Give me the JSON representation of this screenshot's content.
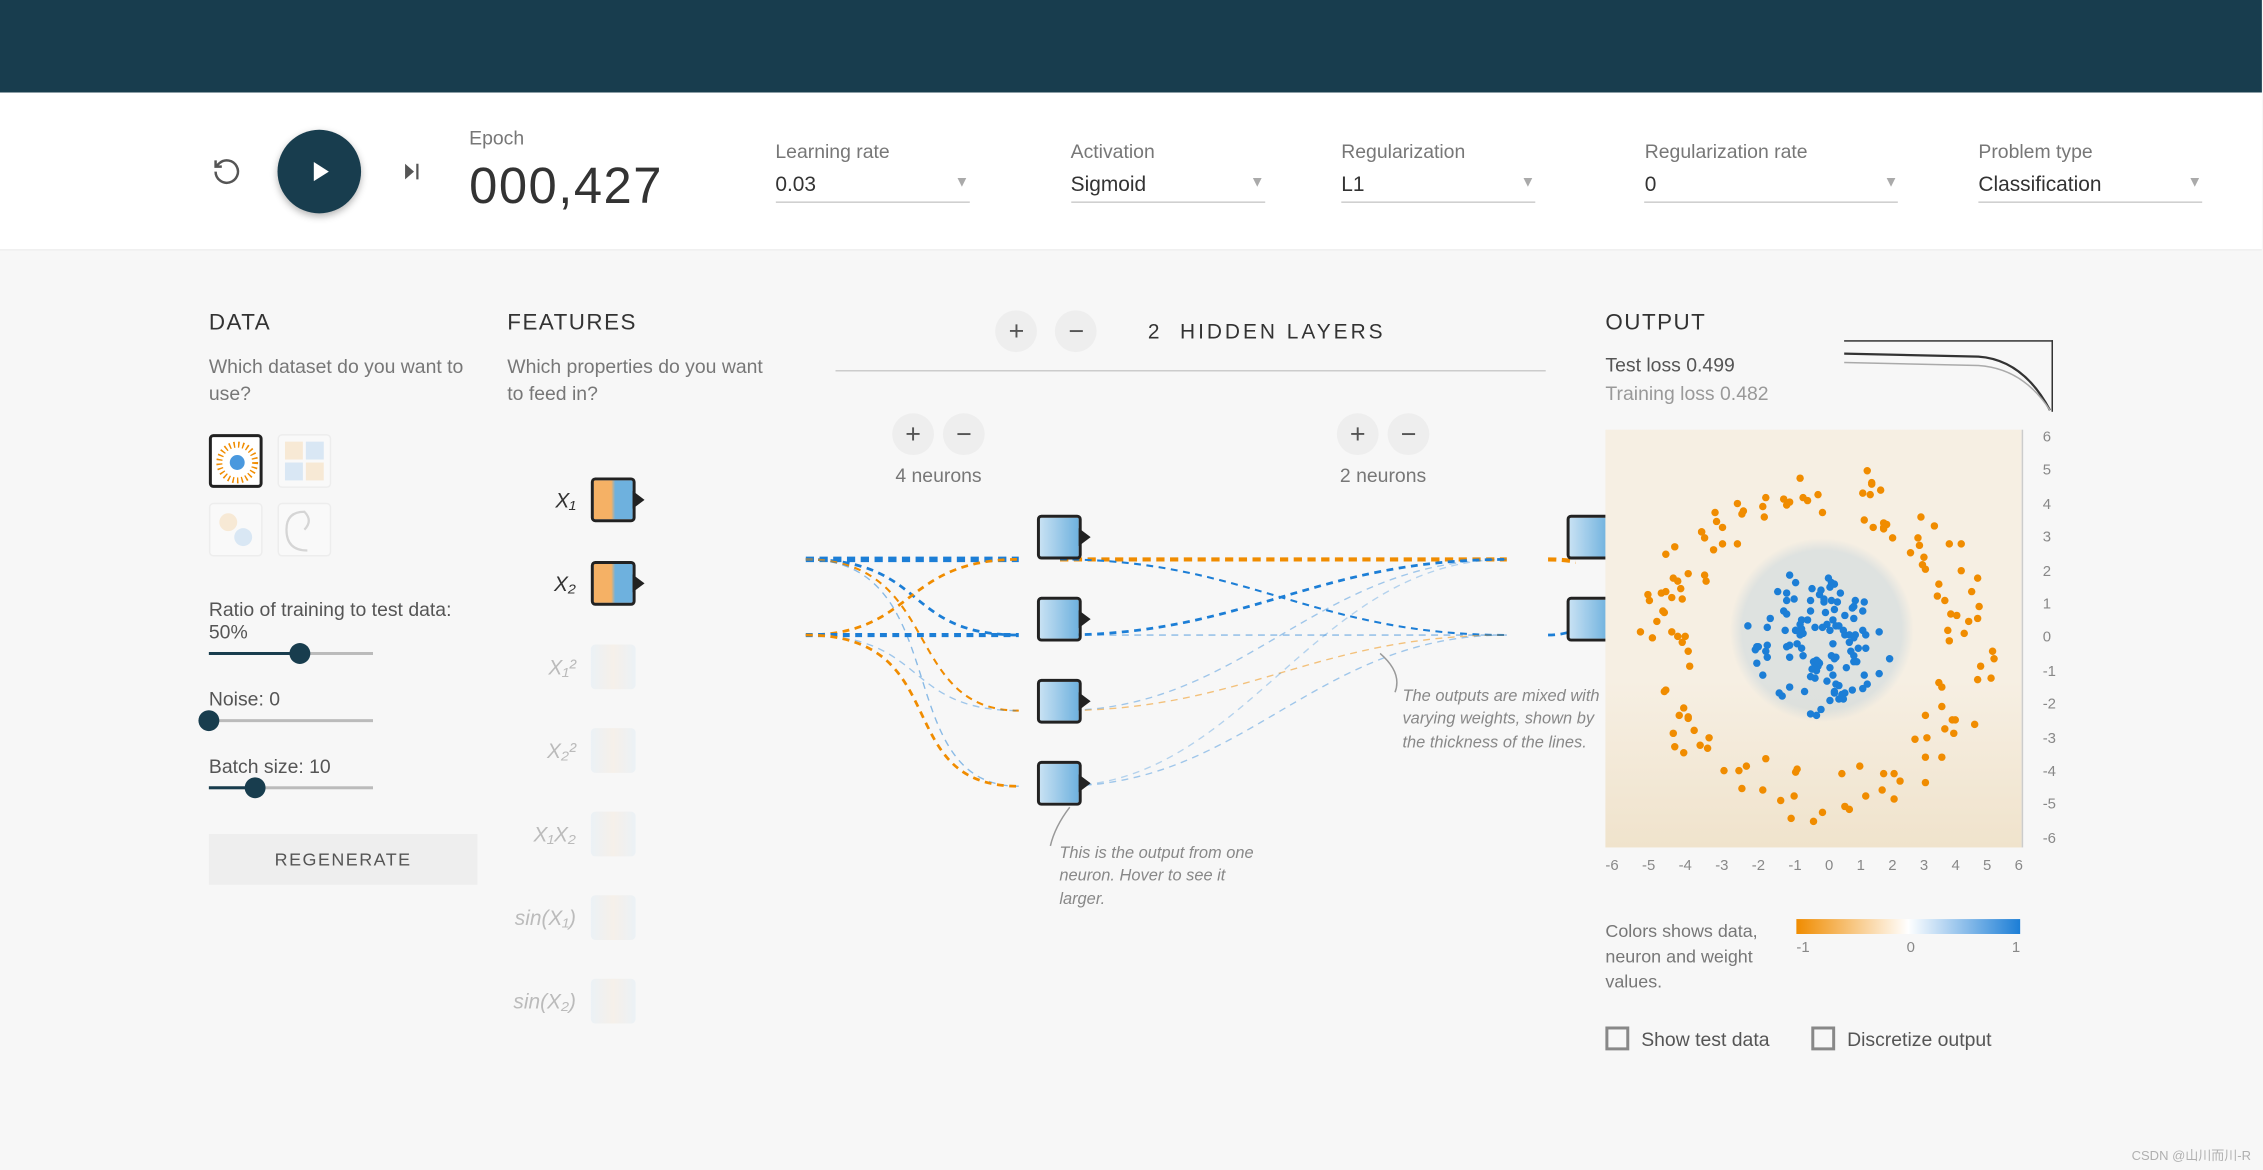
{
  "toolbar": {
    "epoch_label": "Epoch",
    "epoch_value": "000,427",
    "learning_rate_label": "Learning rate",
    "learning_rate_value": "0.03",
    "activation_label": "Activation",
    "activation_value": "Sigmoid",
    "regularization_label": "Regularization",
    "regularization_value": "L1",
    "reg_rate_label": "Regularization rate",
    "reg_rate_value": "0",
    "problem_label": "Problem type",
    "problem_value": "Classification"
  },
  "data_panel": {
    "heading": "DATA",
    "subtext": "Which dataset do you want to use?",
    "ratio_label": "Ratio of training to test data:  50%",
    "noise_label": "Noise:  0",
    "batch_label": "Batch size:  10",
    "regenerate": "REGENERATE"
  },
  "features": {
    "heading": "FEATURES",
    "subtext": "Which properties do you want to feed in?",
    "items": [
      {
        "label": "X₁",
        "active": true
      },
      {
        "label": "X₂",
        "active": true
      },
      {
        "label": "X₁²",
        "active": false
      },
      {
        "label": "X₂²",
        "active": false
      },
      {
        "label": "X₁X₂",
        "active": false
      },
      {
        "label": "sin(X₁)",
        "active": false
      },
      {
        "label": "sin(X₂)",
        "active": false
      }
    ]
  },
  "network": {
    "title": "HIDDEN LAYERS",
    "count": "2",
    "layers": [
      {
        "neurons_label": "4 neurons",
        "neurons": 4
      },
      {
        "neurons_label": "2 neurons",
        "neurons": 2
      }
    ],
    "callout_neuron": "This is the output from one neuron. Hover to see it larger.",
    "callout_weights": "The outputs are mixed with varying weights, shown by the thickness of the lines."
  },
  "output": {
    "heading": "OUTPUT",
    "test_loss": "Test loss 0.499",
    "train_loss": "Training loss 0.482",
    "ticks": [
      "-6",
      "-5",
      "-4",
      "-3",
      "-2",
      "-1",
      "0",
      "1",
      "2",
      "3",
      "4",
      "5",
      "6"
    ],
    "legend_text": "Colors shows data, neuron and weight values.",
    "grad_ticks": [
      "-1",
      "0",
      "1"
    ],
    "show_test": "Show test data",
    "discretize": "Discretize output"
  },
  "watermark": "CSDN @山川而川-R",
  "colors": {
    "blue": "#1c7ed6",
    "orange": "#f08c00",
    "dark": "#183d4e"
  }
}
